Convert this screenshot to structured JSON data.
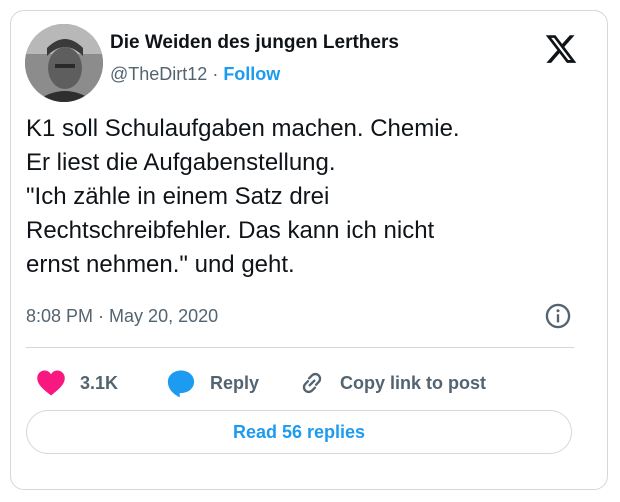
{
  "author": {
    "display_name": "Die Weiden des jungen Lerthers",
    "handle": "@TheDirt12",
    "follow_label": "Follow",
    "avatar_icon": "user-photo-icon"
  },
  "post": {
    "lines": [
      "K1 soll Schulaufgaben machen. Chemie.",
      "Er liest die Aufgabenstellung.",
      "\"Ich zähle in einem Satz drei",
      "Rechtschreibfehler. Das kann ich nicht",
      "ernst nehmen.\" und geht."
    ],
    "time": "8:08 PM",
    "date": "May 20, 2020"
  },
  "actions": {
    "like_count": "3.1K",
    "reply_label": "Reply",
    "copy_label": "Copy link to post"
  },
  "read_replies_label": "Read 56 replies",
  "colors": {
    "accent": "#1d9bf0",
    "like": "#f91880",
    "secondary_text": "#536471",
    "border": "#cfd9de"
  }
}
